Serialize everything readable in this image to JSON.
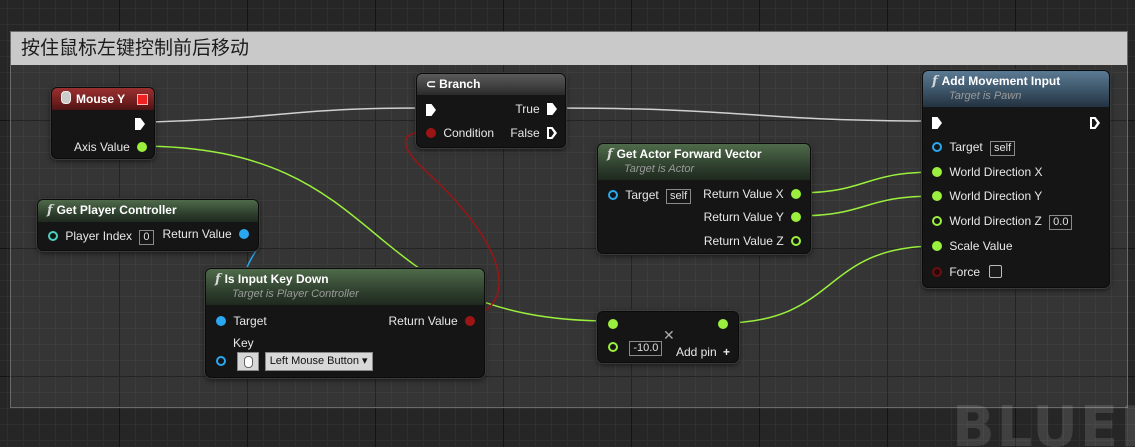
{
  "comment": {
    "title": "按住鼠标左键控制前后移动"
  },
  "watermark": "BLUEPRINT",
  "nodes": {
    "mouse_y": {
      "title": "Mouse Y",
      "axis_value": "Axis Value"
    },
    "branch": {
      "title": "Branch",
      "condition": "Condition",
      "true": "True",
      "false": "False"
    },
    "get_player_controller": {
      "title": "Get Player Controller",
      "player_index": "Player Index",
      "player_index_value": "0",
      "return_value": "Return Value"
    },
    "is_input_key_down": {
      "title": "Is Input Key Down",
      "subtitle": "Target is Player Controller",
      "target": "Target",
      "key": "Key",
      "key_value": "Left Mouse Button",
      "return_value": "Return Value"
    },
    "get_actor_forward_vector": {
      "title": "Get Actor Forward Vector",
      "subtitle": "Target is Actor",
      "target": "Target",
      "target_value": "self",
      "return_x": "Return Value X",
      "return_y": "Return Value Y",
      "return_z": "Return Value Z"
    },
    "multiply": {
      "value": "-10.0",
      "add_pin": "Add pin"
    },
    "add_movement_input": {
      "title": "Add Movement Input",
      "subtitle": "Target is Pawn",
      "target": "Target",
      "target_value": "self",
      "world_x": "World Direction X",
      "world_y": "World Direction Y",
      "world_z": "World Direction Z",
      "world_z_value": "0.0",
      "scale_value": "Scale Value",
      "force": "Force"
    }
  },
  "colors": {
    "exec": "#ffffff",
    "float": "#9af03c",
    "object": "#29a8f1",
    "bool": "#9c1414"
  }
}
